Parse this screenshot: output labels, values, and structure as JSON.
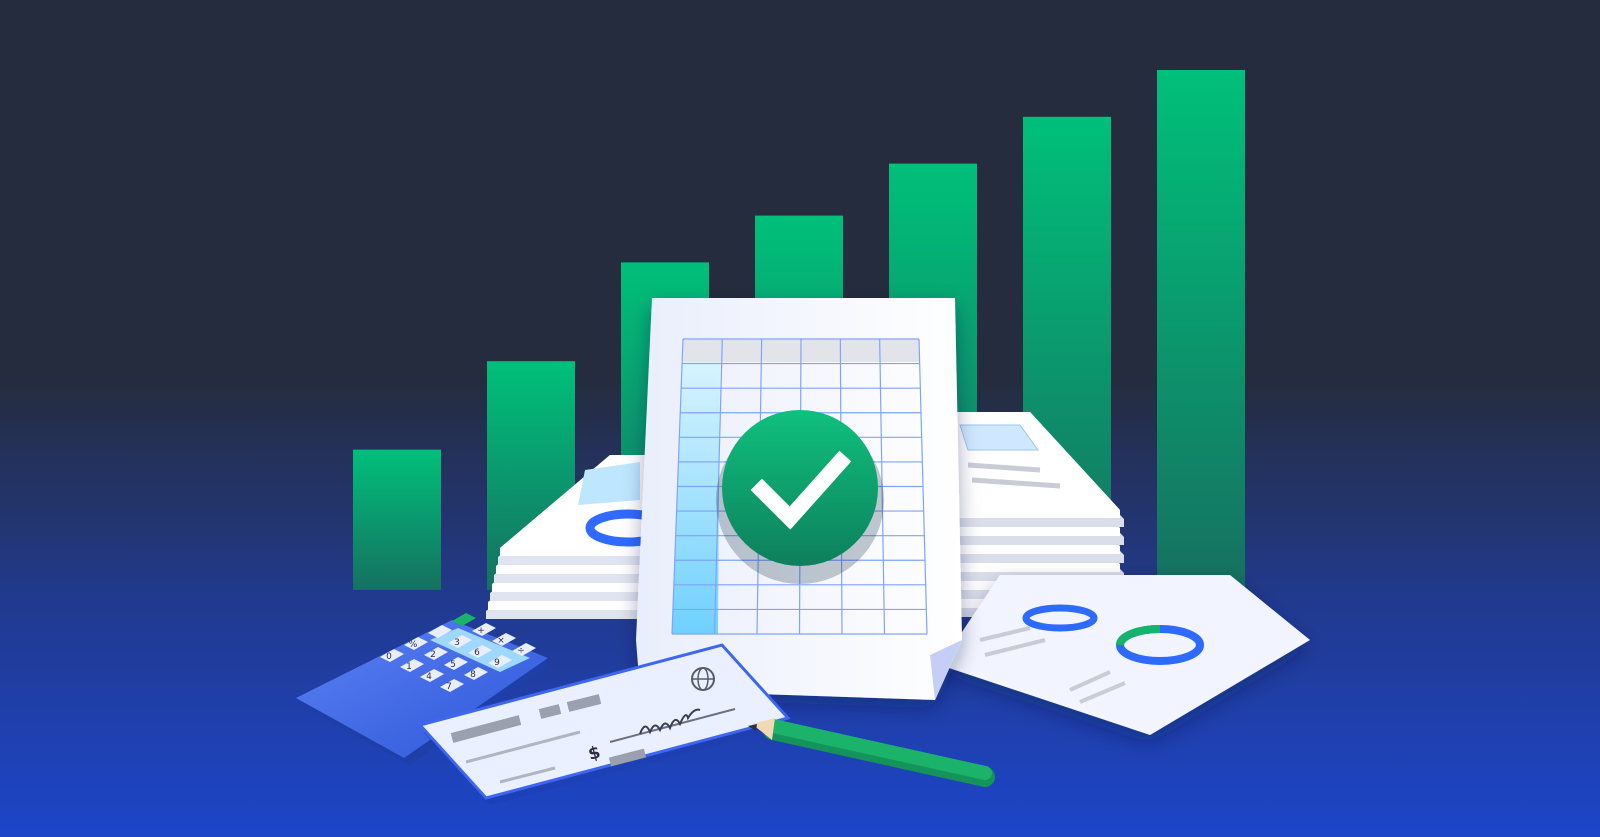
{
  "palette": {
    "bg_top": "#252c3d",
    "bg_bottom": "#1d45c9",
    "bar_top": "#00c07a",
    "bar_bottom": "#167060",
    "check_green": "#13a86d",
    "paper": "#ffffff",
    "grid_line": "#7fa3ff",
    "cyan_column": "#9fe3ff",
    "calculator_blue": "#3d64e6",
    "pencil_green": "#1bb36a",
    "donut_blue": "#2f6bff"
  },
  "growth_bars": {
    "count": 7,
    "relative_heights": [
      0.27,
      0.44,
      0.63,
      0.72,
      0.82,
      0.91,
      1.0
    ]
  },
  "icons": {
    "approval": "check-circle-icon",
    "spreadsheet": "spreadsheet-icon",
    "calculator": "calculator-icon",
    "cheque": "cheque-icon",
    "pencil": "pencil-icon",
    "globe": "globe-icon",
    "dollar": "dollar-sign-icon"
  },
  "calculator": {
    "keys_row1": [
      "7",
      "8",
      "9",
      "÷"
    ],
    "keys_row2": [
      "4",
      "5",
      "6",
      "×"
    ],
    "keys_row3": [
      "1",
      "2",
      "3",
      "+"
    ],
    "keys_row4": [
      "0",
      "%",
      "",
      ""
    ]
  },
  "cheque": {
    "dollar_sign": "$"
  }
}
